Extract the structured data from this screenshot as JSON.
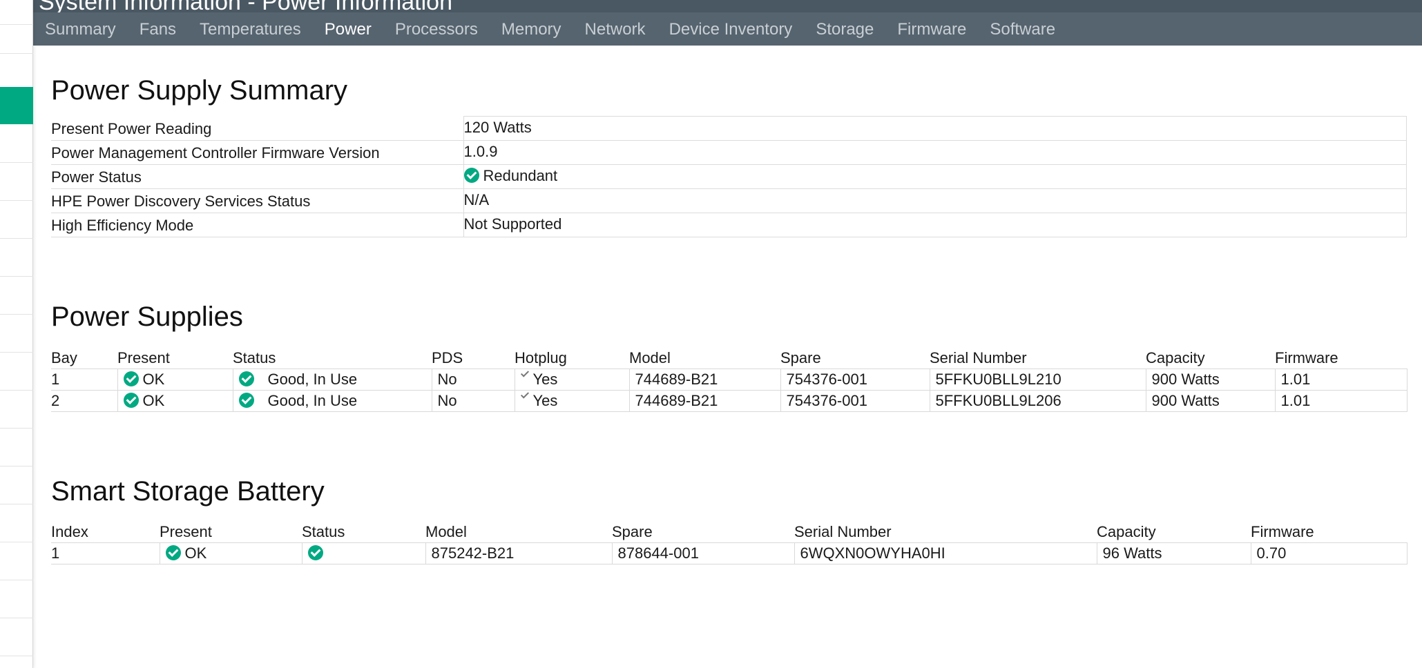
{
  "header": {
    "title": "System Information - Power Information",
    "tabs": [
      "Summary",
      "Fans",
      "Temperatures",
      "Power",
      "Processors",
      "Memory",
      "Network",
      "Device Inventory",
      "Storage",
      "Firmware",
      "Software"
    ],
    "active_tab": "Power"
  },
  "power_summary": {
    "heading": "Power Supply Summary",
    "rows": [
      {
        "label": "Present Power Reading",
        "value": "120 Watts"
      },
      {
        "label": "Power Management Controller Firmware Version",
        "value": "1.0.9"
      },
      {
        "label": "Power Status",
        "value": "Redundant",
        "icon": "ok-check-icon"
      },
      {
        "label": "HPE Power Discovery Services Status",
        "value": "N/A"
      },
      {
        "label": "High Efficiency Mode",
        "value": "Not Supported"
      }
    ]
  },
  "power_supplies": {
    "heading": "Power Supplies",
    "columns": [
      "Bay",
      "Present",
      "Status",
      "PDS",
      "Hotplug",
      "Model",
      "Spare",
      "Serial Number",
      "Capacity",
      "Firmware"
    ],
    "rows": [
      {
        "bay": "1",
        "present": "OK",
        "status": "Good, In Use",
        "pds": "No",
        "hotplug": "Yes",
        "model": "744689-B21",
        "spare": "754376-001",
        "serial": "5FFKU0BLL9L210",
        "capacity": "900 Watts",
        "firmware": "1.01"
      },
      {
        "bay": "2",
        "present": "OK",
        "status": "Good, In Use",
        "pds": "No",
        "hotplug": "Yes",
        "model": "744689-B21",
        "spare": "754376-001",
        "serial": "5FFKU0BLL9L206",
        "capacity": "900 Watts",
        "firmware": "1.01"
      }
    ]
  },
  "battery": {
    "heading": "Smart Storage Battery",
    "columns": [
      "Index",
      "Present",
      "Status",
      "Model",
      "Spare",
      "Serial Number",
      "Capacity",
      "Firmware"
    ],
    "rows": [
      {
        "index": "1",
        "present": "OK",
        "status": "",
        "model": "875242-B21",
        "spare": "878644-001",
        "serial": "6WQXN0OWYHA0HI",
        "capacity": "96 Watts",
        "firmware": "0.70"
      }
    ]
  },
  "colors": {
    "accent": "#01a982",
    "header_bg": "#56646f",
    "tab_text": "#c8cfd4",
    "tab_active": "#ffffff"
  }
}
